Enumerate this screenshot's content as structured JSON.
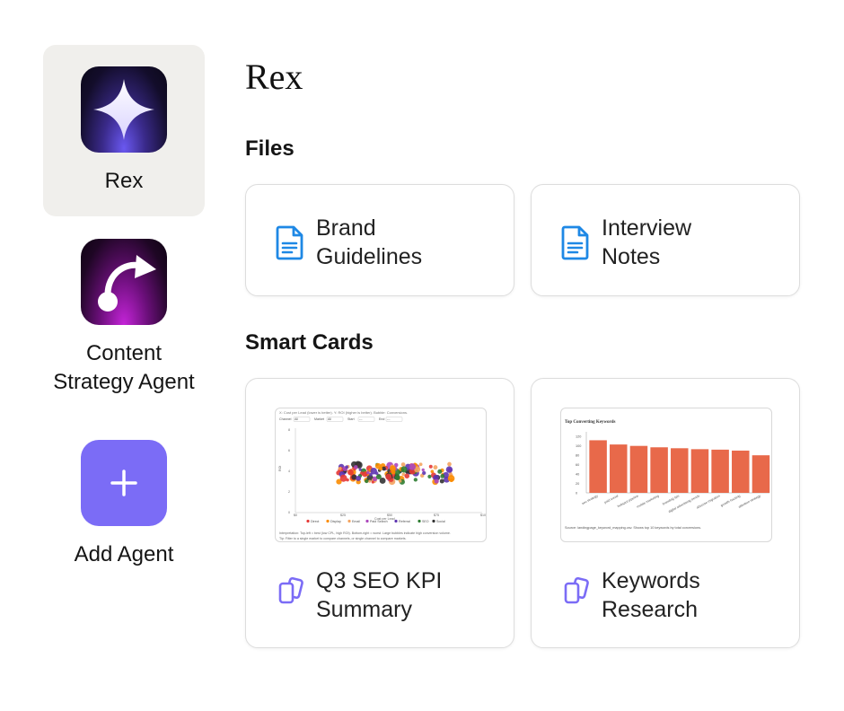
{
  "sidebar": {
    "agents": [
      {
        "label": "Rex",
        "icon": "sparkle-icon",
        "active": true
      },
      {
        "label": "Content\nStrategy Agent",
        "icon": "curved-arrow-icon",
        "active": false
      },
      {
        "label": "Add Agent",
        "icon": "plus-icon",
        "active": false
      }
    ]
  },
  "main": {
    "title": "Rex",
    "files_heading": "Files",
    "files": [
      {
        "label": "Brand\nGuidelines",
        "icon": "document-icon"
      },
      {
        "label": "Interview\nNotes",
        "icon": "document-icon"
      }
    ],
    "smart_cards_heading": "Smart Cards",
    "smart_cards": [
      {
        "label": "Q3 SEO KPI\nSummary",
        "icon": "cards-icon"
      },
      {
        "label": "Keywords\nResearch",
        "icon": "cards-icon"
      }
    ]
  },
  "colors": {
    "accent": "#7b6cf6",
    "doc_icon": "#1e88e5",
    "card_icon": "#7b6cf6",
    "bar": "#e8694a",
    "active_bg": "#f0efec"
  },
  "thumbnails": {
    "scatter": {
      "header_note": "X: Cost per Lead (lower is better). Y: ROI (higher is better). Bubble: Conversions.",
      "filters": [
        "Channel",
        "All",
        "Market",
        "All",
        "Start",
        "---",
        "End",
        "---"
      ],
      "y_ticks": [
        "8",
        "6",
        "4",
        "2",
        "0"
      ],
      "x_ticks": [
        "$0",
        "$25",
        "$50",
        "$75",
        "$100"
      ],
      "y_label": "ROI",
      "x_label": "Cost per Lead",
      "legend": [
        "Direct",
        "Display",
        "Email",
        "Paid Search",
        "Referral",
        "SEO",
        "Social"
      ],
      "footer_1": "Interpretation: Top-left = best (low CPL, high ROI). Bottom-right = worst. Large bubbles indicate high conversion volume.",
      "footer_2": "Tip: Filter to a single market to compare channels, or single channel to compare markets."
    },
    "bars": {
      "title": "Top Converting Keywords",
      "source": "Source: landingpage_keyword_mapping.csv. Shows top 10 keywords by total conversions."
    }
  },
  "chart_data": [
    {
      "type": "scatter",
      "title": "",
      "xlabel": "Cost per Lead",
      "ylabel": "ROI",
      "xlim": [
        0,
        100
      ],
      "ylim": [
        0,
        8
      ],
      "series": [
        {
          "name": "Direct",
          "color": "#e53935"
        },
        {
          "name": "Display",
          "color": "#fb8c00"
        },
        {
          "name": "Email",
          "color": "#f4a460"
        },
        {
          "name": "Paid Search",
          "color": "#ab47bc"
        },
        {
          "name": "Referral",
          "color": "#5e35b1"
        },
        {
          "name": "SEO",
          "color": "#2e7d32"
        },
        {
          "name": "Social",
          "color": "#333333"
        }
      ]
    },
    {
      "type": "bar",
      "title": "Top Converting Keywords",
      "categories": [
        "seo strategy",
        "paid social",
        "hubspot pipeline",
        "mobile marketing",
        "branding tips",
        "digital advertising trends",
        "abscuse migration",
        "growth hacking",
        "attention strategy"
      ],
      "values": [
        112,
        103,
        100,
        97,
        95,
        93,
        92,
        90,
        80
      ],
      "ylim": [
        0,
        130
      ],
      "y_ticks": [
        0,
        20,
        40,
        60,
        80,
        100,
        120
      ]
    }
  ]
}
